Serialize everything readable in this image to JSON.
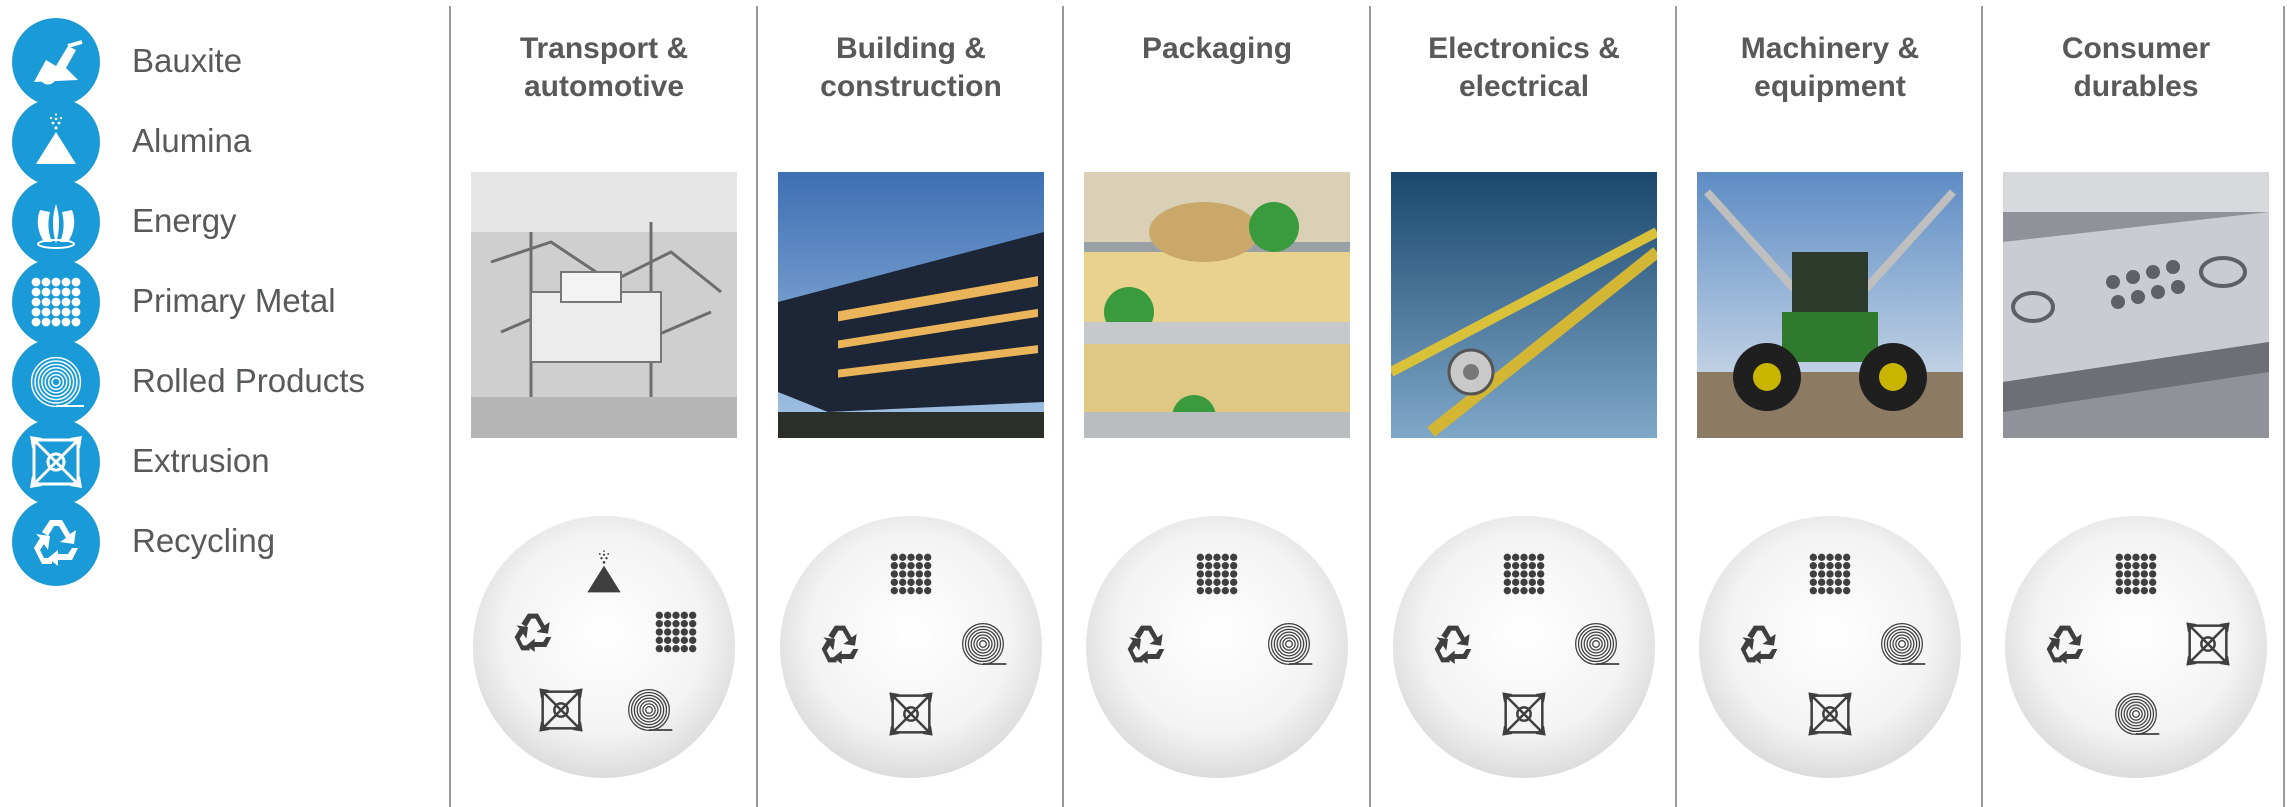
{
  "legend": [
    {
      "key": "bauxite",
      "label": "Bauxite",
      "icon": "bauxite-icon"
    },
    {
      "key": "alumina",
      "label": "Alumina",
      "icon": "alumina-icon"
    },
    {
      "key": "energy",
      "label": "Energy",
      "icon": "energy-icon"
    },
    {
      "key": "primary",
      "label": "Primary Metal",
      "icon": "primary-metal-icon"
    },
    {
      "key": "rolled",
      "label": "Rolled Products",
      "icon": "rolled-products-icon"
    },
    {
      "key": "extrusion",
      "label": "Extrusion",
      "icon": "extrusion-icon"
    },
    {
      "key": "recycling",
      "label": "Recycling",
      "icon": "recycling-icon"
    }
  ],
  "colors": {
    "badge": "#1a9ad6",
    "label": "#58595b",
    "title": "#595959",
    "divider": "#9a9a9a",
    "glyph": "#3f3f3f"
  },
  "markets": [
    {
      "title_lines": [
        "Transport &",
        "automotive"
      ],
      "photo": "car-assembly-line-photo",
      "segments": [
        "alumina",
        "recycling",
        "primary",
        "extrusion",
        "rolled"
      ]
    },
    {
      "title_lines": [
        "Building &",
        "construction"
      ],
      "photo": "glass-building-photo",
      "segments": [
        "primary",
        "recycling",
        "rolled",
        "extrusion"
      ]
    },
    {
      "title_lines": [
        "Packaging"
      ],
      "photo": "foil-food-trays-photo",
      "segments": [
        "primary",
        "recycling",
        "rolled"
      ]
    },
    {
      "title_lines": [
        "Electronics &",
        "electrical"
      ],
      "photo": "aluminium-cable-photo",
      "segments": [
        "primary",
        "recycling",
        "rolled",
        "extrusion"
      ]
    },
    {
      "title_lines": [
        "Machinery &",
        "equipment"
      ],
      "photo": "green-tractor-photo",
      "segments": [
        "primary",
        "recycling",
        "rolled",
        "extrusion"
      ]
    },
    {
      "title_lines": [
        "Consumer",
        "durables"
      ],
      "photo": "appliance-panel-photo",
      "segments": [
        "primary",
        "recycling",
        "extrusion",
        "rolled"
      ]
    }
  ]
}
